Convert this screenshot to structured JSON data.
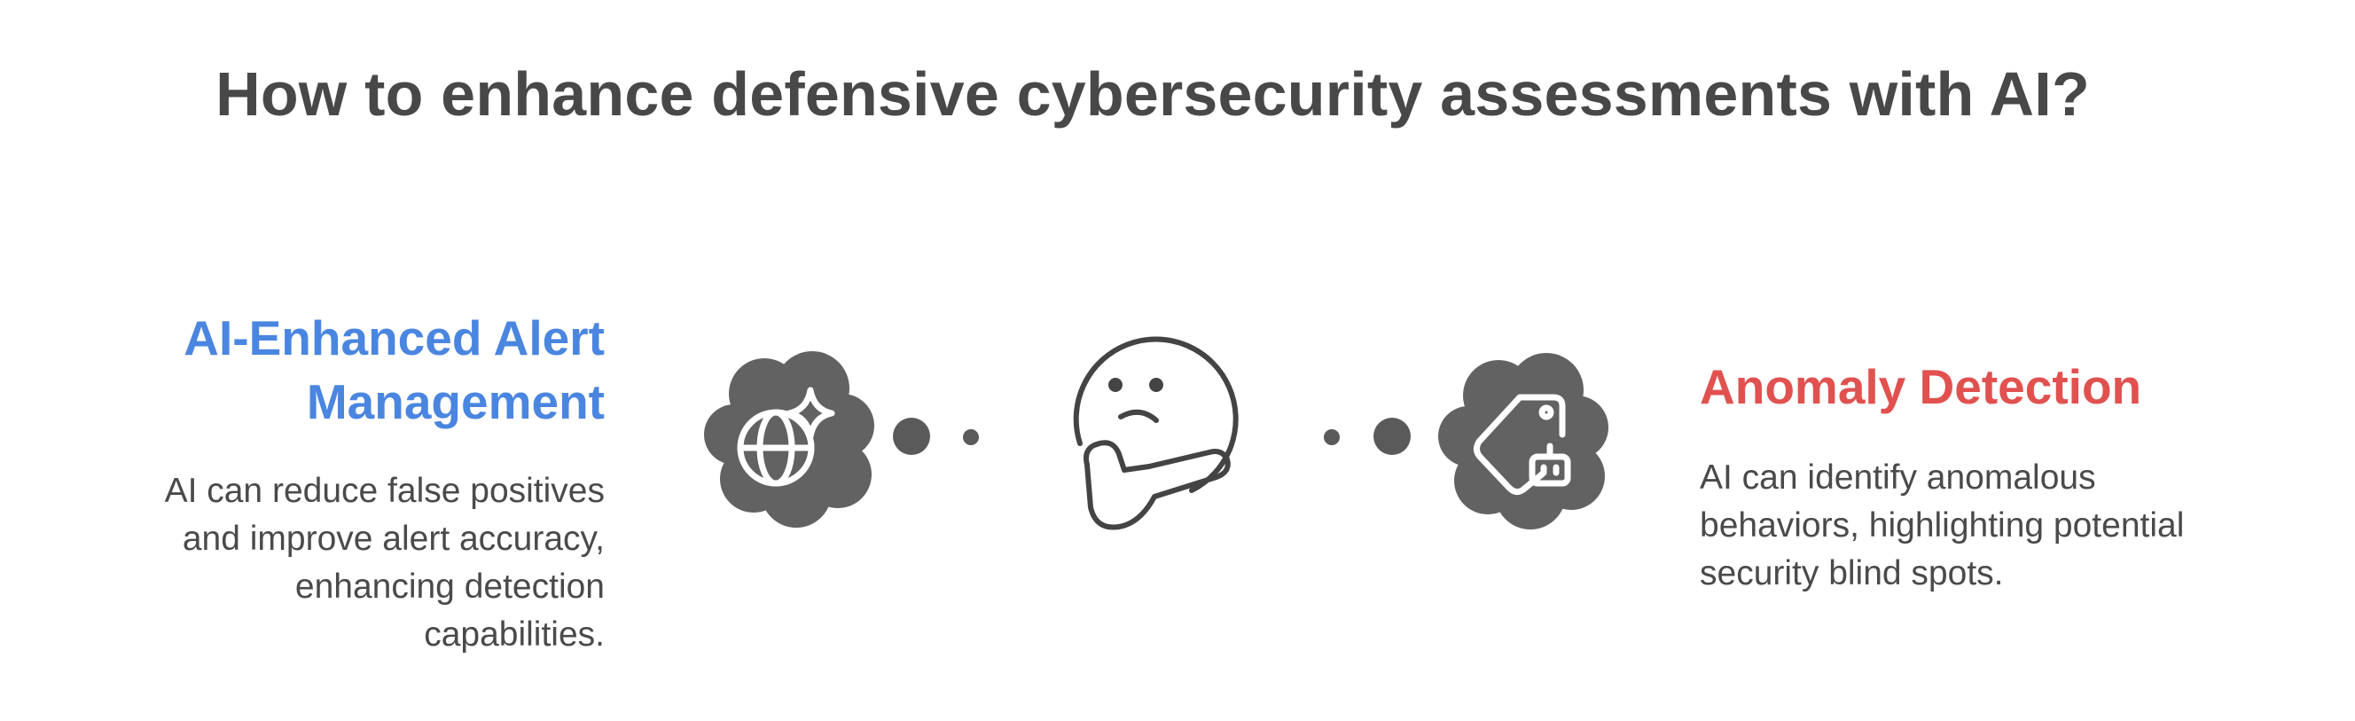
{
  "title": "How to enhance defensive cybersecurity assessments with AI?",
  "left": {
    "heading_lines": [
      "AI-Enhanced Alert",
      "Management"
    ],
    "description_lines": [
      "AI can reduce false positives",
      "and improve alert accuracy,",
      "enhancing detection",
      "capabilities."
    ],
    "icon": "globe-sparkle-icon",
    "color": "#4a86e0"
  },
  "center": {
    "icon": "thinking-face-icon"
  },
  "right": {
    "heading": "Anomaly Detection",
    "description_lines": [
      "AI can identify anomalous",
      "behaviors, highlighting potential",
      "security blind spots."
    ],
    "icon": "tag-robot-icon",
    "color": "#e0514f"
  },
  "colors": {
    "title": "#484848",
    "text": "#4a4a4a",
    "icon_fill": "#626262",
    "icon_stroke": "#444444"
  }
}
